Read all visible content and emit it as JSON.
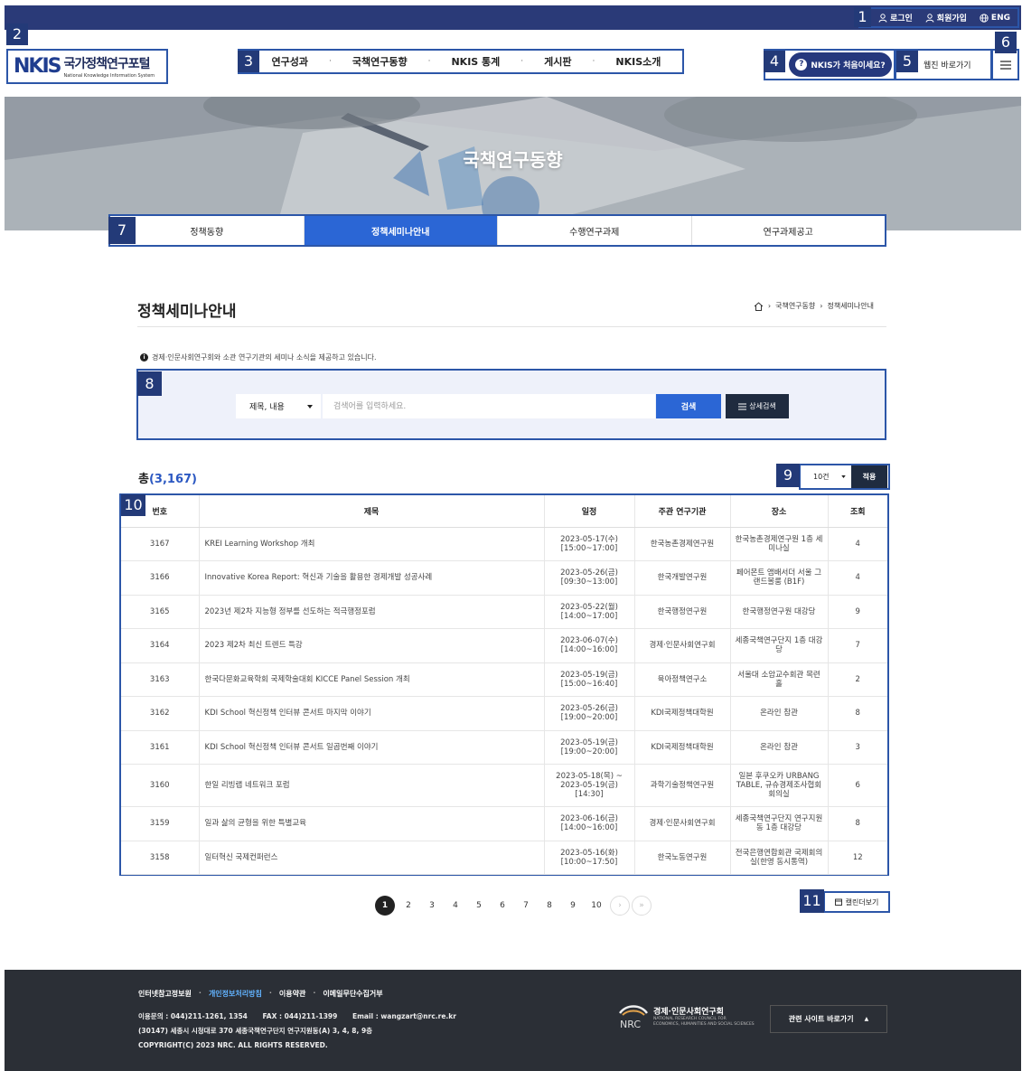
{
  "utility": {
    "login": "로그인",
    "join": "회원가입",
    "lang": "ENG"
  },
  "logo": {
    "mark": "NKIS",
    "name_ko": "국가정책연구포털",
    "name_en": "National Knowledge Information System"
  },
  "gnb": [
    "연구성과",
    "국책연구동향",
    "NKIS 통계",
    "게시판",
    "NKIS소개"
  ],
  "gnb_sep": "·",
  "header": {
    "first_visit": "NKIS가 처음이세요?",
    "first_visit_icon": "?",
    "webzine": "웹진 바로가기"
  },
  "hero": {
    "title": "국책연구동향"
  },
  "subtabs": [
    {
      "label": "정책동향",
      "active": false
    },
    {
      "label": "정책세미나안내",
      "active": true
    },
    {
      "label": "수행연구과제",
      "active": false
    },
    {
      "label": "연구과제공고",
      "active": false
    }
  ],
  "page": {
    "title": "정책세미나안내",
    "breadcrumb": [
      "국책연구동향",
      "정책세미나안내"
    ],
    "breadcrumb_sep": "›",
    "notice_icon": "i",
    "notice": "경제·인문사회연구회와 소관 연구기관의 세미나 소식을 제공하고 있습니다."
  },
  "search": {
    "field_value": "제목, 내용",
    "placeholder": "검색어를 입력하세요.",
    "search_label": "검색",
    "advanced_label": "상세검색"
  },
  "summary": {
    "total_prefix": "총",
    "total_count": "(3,167)",
    "per_page": "10건",
    "apply": "적용"
  },
  "table": {
    "headers": [
      "번호",
      "제목",
      "일정",
      "주관 연구기관",
      "장소",
      "조회"
    ],
    "rows": [
      {
        "no": "3167",
        "title": "KREI Learning Workshop 개최",
        "date1": "2023-05-17(수)",
        "date2": "[15:00~17:00]",
        "date3": "",
        "org": "한국농촌경제연구원",
        "place": "한국농촌경제연구원 1층 세미나실",
        "views": "4"
      },
      {
        "no": "3166",
        "title": "Innovative Korea Report: 혁신과 기술을 활용한 경제개발 성공사례",
        "date1": "2023-05-26(금)",
        "date2": "[09:30~13:00]",
        "date3": "",
        "org": "한국개발연구원",
        "place": "페어몬트 앰배서더 서울 그랜드볼룸 (B1F)",
        "views": "4"
      },
      {
        "no": "3165",
        "title": "2023년 제2차 지능형 정부를 선도하는 적극행정포럼",
        "date1": "2023-05-22(월)",
        "date2": "[14:00~17:00]",
        "date3": "",
        "org": "한국행정연구원",
        "place": "한국행정연구원 대강당",
        "views": "9"
      },
      {
        "no": "3164",
        "title": "2023 제2차 최신 트렌드 특강",
        "date1": "2023-06-07(수)",
        "date2": "[14:00~16:00]",
        "date3": "",
        "org": "경제·인문사회연구회",
        "place": "세종국책연구단지 1층 대강당",
        "views": "7"
      },
      {
        "no": "3163",
        "title": "한국다문화교육학회 국제학술대회 KICCE Panel Session 개최",
        "date1": "2023-05-19(금)",
        "date2": "[15:00~16:40]",
        "date3": "",
        "org": "육아정책연구소",
        "place": "서울대 소암교수회관 목련홀",
        "views": "2"
      },
      {
        "no": "3162",
        "title": "KDI School 혁신정책 인터뷰 콘서트 마지막 이야기",
        "date1": "2023-05-26(금)",
        "date2": "[19:00~20:00]",
        "date3": "",
        "org": "KDI국제정책대학원",
        "place": "온라인 참관",
        "views": "8"
      },
      {
        "no": "3161",
        "title": "KDI School 혁신정책 인터뷰 콘서트 일곱번째 이야기",
        "date1": "2023-05-19(금)",
        "date2": "[19:00~20:00]",
        "date3": "",
        "org": "KDI국제정책대학원",
        "place": "온라인 참관",
        "views": "3"
      },
      {
        "no": "3160",
        "title": "한일 리빙랩 네트워크 포럼",
        "date1": "2023-05-18(목) ~",
        "date2": "2023-05-19(금)",
        "date3": "[14:30]",
        "org": "과학기술정책연구원",
        "place": "일본 후쿠오카 URBANG TABLE, 규슈경제조사협회 회의실",
        "views": "6"
      },
      {
        "no": "3159",
        "title": "일과 삶의 균형을 위한 특별교육",
        "date1": "2023-06-16(금)",
        "date2": "[14:00~16:00]",
        "date3": "",
        "org": "경제·인문사회연구회",
        "place": "세종국책연구단지 연구지원동 1층 대강당",
        "views": "8"
      },
      {
        "no": "3158",
        "title": "일터혁신 국제컨퍼런스",
        "date1": "2023-05-16(화)",
        "date2": "[10:00~17:50]",
        "date3": "",
        "org": "한국노동연구원",
        "place": "전국은행연합회관 국제회의실(한영 동시통역)",
        "views": "12"
      }
    ]
  },
  "pagination": {
    "pages": [
      "1",
      "2",
      "3",
      "4",
      "5",
      "6",
      "7",
      "8",
      "9",
      "10"
    ],
    "current": "1",
    "next": "›",
    "last": "»"
  },
  "calendar_button": "캘린더보기",
  "footer": {
    "links": [
      "인터넷참고정보원",
      "개인정보처리방침",
      "이용약관",
      "이메일무단수집거부"
    ],
    "link_sep": "·",
    "contact_label": "이용문의 :",
    "contact": "044)211-1261, 1354",
    "fax_label": "FAX :",
    "fax": "044)211-1399",
    "email_label": "Email :",
    "email": "wangzart@nrc.re.kr",
    "address": "(30147) 세종시 시청대로 370 세종국책연구단지 연구지원동(A) 3, 4, 8, 9층",
    "copyright": "COPYRIGHT(C) 2023 NRC. ALL RIGHTS RESERVED.",
    "nrc_name": "경제·인문사회연구회",
    "nrc_mark": "NRC",
    "nrc_en1": "NATIONAL RESEARCH COUNCIL FOR",
    "nrc_en2": "ECONOMICS, HUMANITIES AND SOCIAL SCIENCES",
    "related": "관련 사이트 바로가기",
    "related_arrow": "▲"
  },
  "markers": [
    "1",
    "2",
    "3",
    "4",
    "5",
    "6",
    "7",
    "8",
    "9",
    "10",
    "11"
  ],
  "colors": {
    "navy": "#2a3a78",
    "accent": "#2b66d5",
    "marker": "#233a78",
    "outline": "#2c56a8"
  }
}
